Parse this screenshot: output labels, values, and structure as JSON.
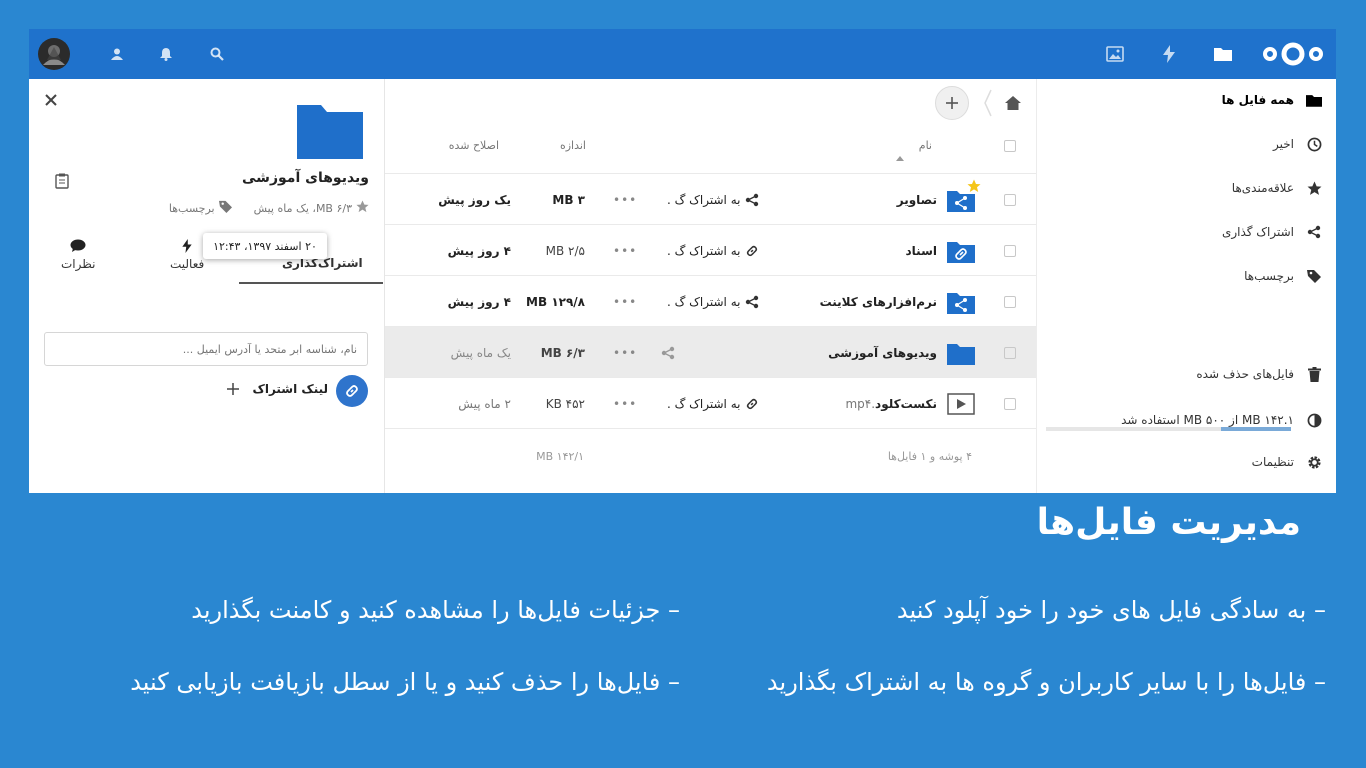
{
  "colors": {
    "background": "#2a87d1",
    "topbar": "#1f72cc",
    "folder": "#1f6fca",
    "accent_blue": "#2f74cc"
  },
  "topbar": {
    "icons": [
      "logo",
      "files-icon",
      "activity-icon",
      "gallery-icon",
      "search-icon",
      "notifications-icon",
      "contacts-icon",
      "avatar"
    ]
  },
  "sidebar": {
    "items": [
      {
        "label": "همه فایل ها",
        "icon": "folder-icon"
      },
      {
        "label": "اخیر",
        "icon": "clock-icon"
      },
      {
        "label": "علاقه‌مندی‌ها",
        "icon": "star-icon"
      },
      {
        "label": "اشتراک گذاری",
        "icon": "share-icon"
      },
      {
        "label": "برچسب‌ها",
        "icon": "tag-icon"
      }
    ],
    "deleted_files": "فایل‌های حذف شده",
    "quota_text": "MB ۱۴۲.۱ از MB ۵۰۰ استفاده شد",
    "quota_fraction": 0.284,
    "settings": "تنظیمات"
  },
  "files": {
    "headers": {
      "name": "نام",
      "size": "اندازه",
      "modified": "اصلاح شده"
    },
    "rows": [
      {
        "name": "تصاویر",
        "ext": "",
        "share": "به اشتراک گ .",
        "size": "MB ۳",
        "modified": "یک روز پیش"
      },
      {
        "name": "اسناد",
        "ext": "",
        "share": "به اشتراک گ .",
        "size": "MB ۲/۵",
        "modified": "۴ روز پیش"
      },
      {
        "name": "نرم‌افزارهای کلاینت",
        "ext": "",
        "share": "به اشتراک گ .",
        "size": "MB ۱۲۹/۸",
        "modified": "۴ روز پیش"
      },
      {
        "name": "ویدیوهای آموزشی",
        "ext": "",
        "share": "",
        "size": "MB ۶/۳",
        "modified": "یک ماه پیش"
      },
      {
        "name": "نکست‌کلود",
        "ext": ".mp۴",
        "share": "به اشتراک گ .",
        "size": "KB ۴۵۲",
        "modified": "۲ ماه پیش"
      }
    ],
    "summary": "۴ پوشه و ۱ فایل‌ها",
    "total_size": "MB ۱۴۲/۱"
  },
  "detail": {
    "title": "ویدیوهای آموزشی",
    "meta": "MB ۶/۳، یک ماه پیش",
    "tags": "برچسب‌ها",
    "tooltip": "۲۰ اسفند ۱۳۹۷، ۱۲:۴۳",
    "tabs": {
      "sharing": "اشتراک‌گذاری",
      "activity": "فعالیت",
      "comments": "نظرات"
    },
    "share_placeholder": "نام، شناسه ابر متحد یا آدرس ایمیل ...",
    "share_link": "لینک اشتراک"
  },
  "slide": {
    "title": "مدیریت فایل‌ها",
    "bullets": [
      "– به سادگی فایل های خود را خود آپلود کنید",
      "– جزئیات فایل‌ها را مشاهده کنید و کامنت بگذارید",
      "– فایل‌ها را با سایر کاربران و گروه ها به اشتراک بگذارید",
      "– فایل‌ها را حذف کنید و یا از سطل بازیافت بازیابی کنید"
    ]
  }
}
